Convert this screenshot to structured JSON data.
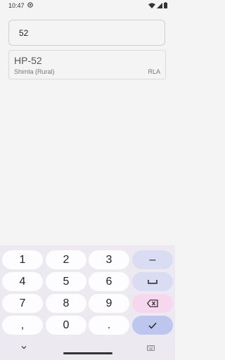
{
  "status": {
    "time": "10:47"
  },
  "search": {
    "value": "52"
  },
  "result": {
    "code": "HP-52",
    "district": "Shimla (Rural)",
    "abbr": "RLA"
  },
  "keyboard": {
    "rows": [
      [
        "1",
        "2",
        "3"
      ],
      [
        "4",
        "5",
        "6"
      ],
      [
        "7",
        "8",
        "9"
      ],
      [
        ",",
        "0",
        "."
      ]
    ],
    "minus": "–"
  },
  "colors": {
    "background": "#f4f4f5",
    "keyboard_bg": "#ede9f0",
    "key_bg": "#fdfcff",
    "fn_key_bg": "#d9dcf2",
    "delete_key_bg": "#f6d7ee",
    "enter_key_bg": "#bcc6ee"
  },
  "icons": {
    "status_left": "notification-icon",
    "status_right": [
      "wifi-icon",
      "signal-icon",
      "battery-icon"
    ],
    "space": "space-icon",
    "delete": "backspace-icon",
    "enter": "checkmark-icon",
    "nav_back": "chevron-down-icon",
    "nav_keyboard": "keyboard-icon"
  }
}
